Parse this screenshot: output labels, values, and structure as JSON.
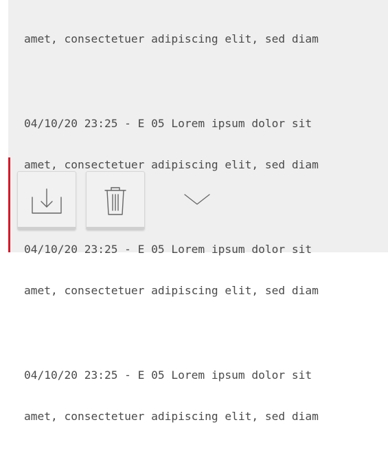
{
  "log": {
    "partial_line": "amet, consectetuer adipiscing elit, sed diam",
    "entries": [
      {
        "line1": "04/10/20 23:25 - E 05 Lorem ipsum dolor sit",
        "line2": "amet, consectetuer adipiscing elit, sed diam"
      },
      {
        "line1": "04/10/20 23:25 - E 05 Lorem ipsum dolor sit",
        "line2": "amet, consectetuer adipiscing elit, sed diam"
      },
      {
        "line1": "04/10/20 23:25 - E 05 Lorem ipsum dolor sit",
        "line2": "amet, consectetuer adipiscing elit, sed diam"
      }
    ]
  },
  "actions": {
    "download_icon": "download-tray-icon",
    "delete_icon": "trash-icon",
    "expand_icon": "chevron-down-icon"
  },
  "colors": {
    "panel_bg": "#efefef",
    "text": "#4a4a4a",
    "accent": "#d51a2b"
  }
}
